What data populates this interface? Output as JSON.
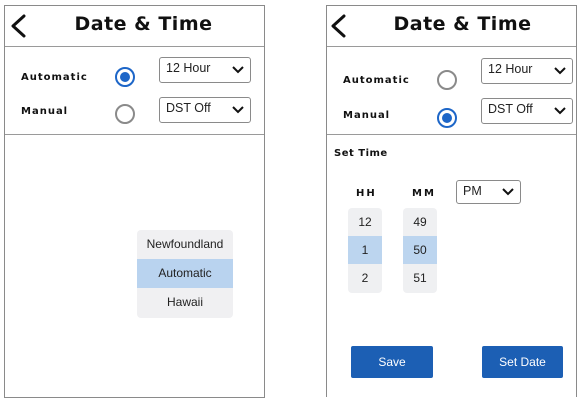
{
  "left_screen": {
    "title": "Date & Time",
    "automatic_label": "Automatic",
    "manual_label": "Manual",
    "hour_format": "12 Hour",
    "dst": "DST Off",
    "timezone_options": [
      "Newfoundland",
      "Automatic",
      "Hawaii"
    ],
    "timezone_selected": "Automatic"
  },
  "right_screen": {
    "title": "Date & Time",
    "automatic_label": "Automatic",
    "manual_label": "Manual",
    "hour_format": "12 Hour",
    "dst": "DST Off",
    "set_time_label": "Set Time",
    "hh_label": "HH",
    "mm_label": "MM",
    "ampm": "PM",
    "hours": [
      "12",
      "1",
      "2"
    ],
    "minutes": [
      "49",
      "50",
      "51"
    ],
    "save_label": "Save",
    "set_date_label": "Set Date"
  },
  "colors": {
    "accent": "#1d66c8",
    "button": "#1c5fb4",
    "highlight": "#b9d3ef"
  },
  "icons": {
    "back": "chevron-left-icon",
    "dropdown": "chevron-down-icon"
  }
}
